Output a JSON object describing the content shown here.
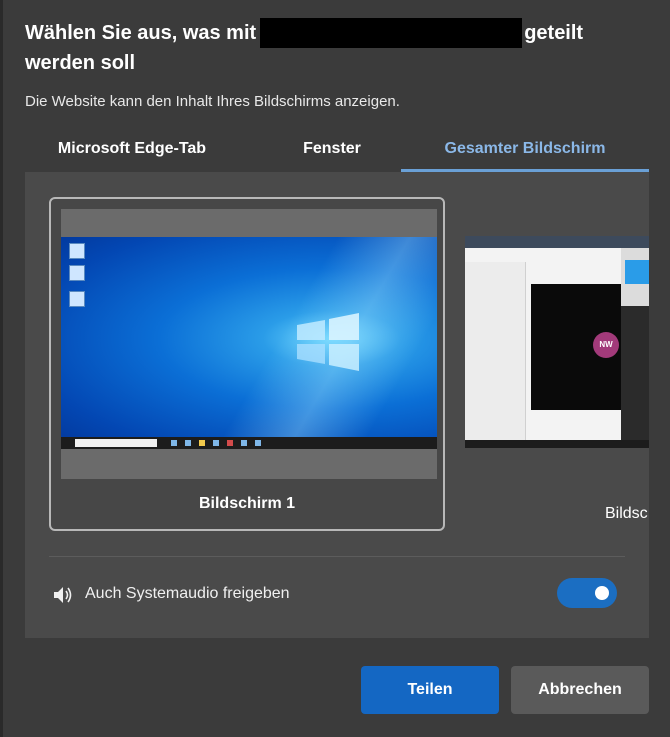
{
  "dialog": {
    "title_prefix": "Wählen Sie aus, was mit",
    "title_suffix_line1": "geteilt",
    "title_line2": "werden soll",
    "subtitle": "Die Website kann den Inhalt Ihres Bildschirms anzeigen."
  },
  "tabs": [
    {
      "label": "Microsoft Edge-Tab",
      "active": false
    },
    {
      "label": "Fenster",
      "active": false
    },
    {
      "label": "Gesamter Bildschirm",
      "active": true
    }
  ],
  "screens": [
    {
      "label": "Bildschirm 1",
      "selected": true
    },
    {
      "label": "Bildsc",
      "selected": false,
      "avatar_initials": "NW"
    }
  ],
  "audio": {
    "icon": "speaker-icon",
    "label": "Auch Systemaudio freigeben",
    "enabled": true
  },
  "buttons": {
    "share": "Teilen",
    "cancel": "Abbrechen"
  },
  "colors": {
    "accent": "#1467c3",
    "active_tab": "#8bb8e8",
    "dialog_bg": "#3b3b3b",
    "panel_bg": "#4a4a4a"
  }
}
